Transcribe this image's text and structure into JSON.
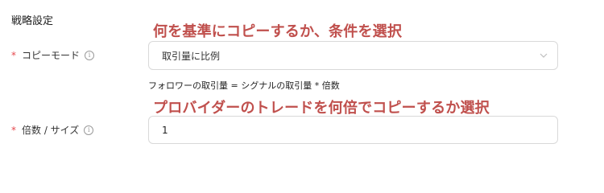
{
  "section": {
    "title": "戦略設定"
  },
  "annotations": {
    "note1": "何を基準にコピーするか、条件を選択",
    "note2": "プロバイダーのトレードを何倍でコピーするか選択"
  },
  "copy_mode": {
    "required_mark": "*",
    "label": "コピーモード",
    "info_icon": "ⓘ",
    "selected_value": "取引量に比例",
    "formula": "フォロワーの取引量 = シグナルの取引量 * 倍数"
  },
  "multiplier": {
    "required_mark": "*",
    "label": "倍数 / サイズ",
    "info_icon": "ⓘ",
    "value": "1"
  },
  "colors": {
    "annotation": "#c0504d",
    "required": "#e5484d",
    "border": "#d9d9d9"
  }
}
